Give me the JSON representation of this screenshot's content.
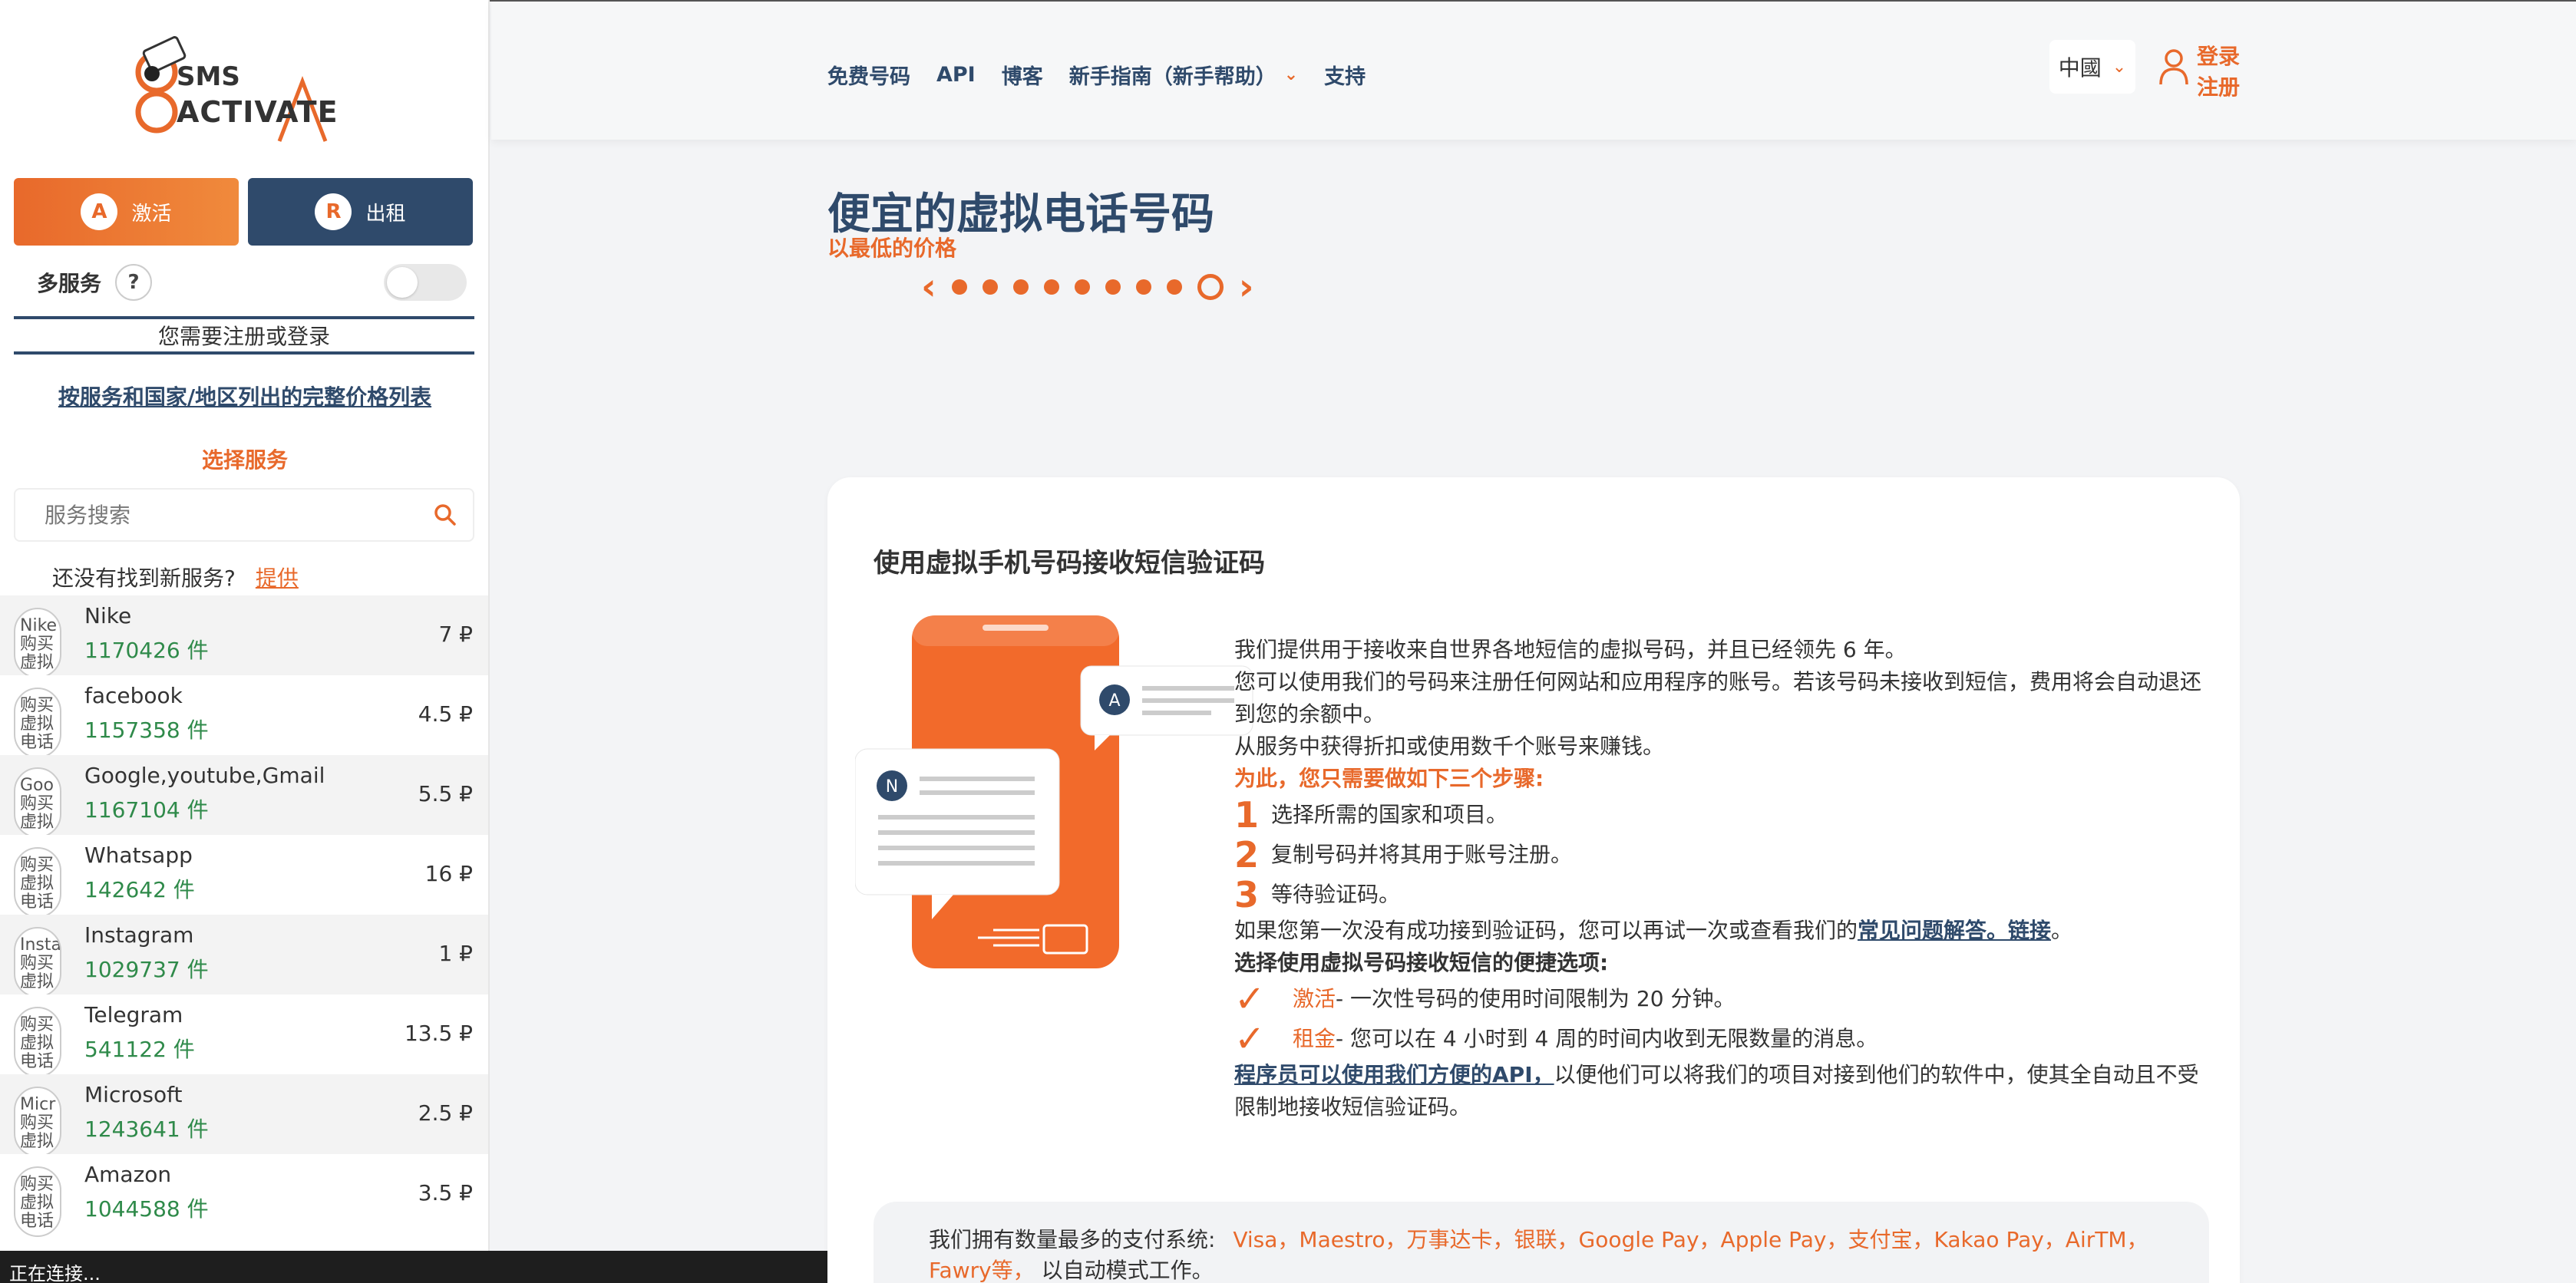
{
  "sidebar": {
    "logo": {
      "line1": "SMS",
      "line2": "ACTIVATE"
    },
    "modes": {
      "activate": "激活",
      "rent": "出租",
      "activate_icon_letter": "A",
      "rent_icon_letter": "R"
    },
    "multi_service_label": "多服务",
    "help_symbol": "?",
    "need_login": "您需要注册或登录",
    "price_list_link": "按服务和国家/地区列出的完整价格列表",
    "choose_service": "选择服务",
    "search_placeholder": "服务搜索",
    "not_found_text": "还没有找到新服务?",
    "offer_link": "提供",
    "services": [
      {
        "name": "Nike",
        "count": "1170426 件",
        "price": "7 ₽",
        "icon_alt": "Nike 购买虚拟",
        "icon": "nike-logo"
      },
      {
        "name": "facebook",
        "count": "1157358 件",
        "price": "4.5 ₽",
        "icon_alt": "购买虚拟电话",
        "icon": "facebook-logo"
      },
      {
        "name": "Google,youtube,Gmail",
        "count": "1167104 件",
        "price": "5.5 ₽",
        "icon_alt": "Goo 购买虚拟",
        "icon": "google-logo"
      },
      {
        "name": "Whatsapp",
        "count": "142642 件",
        "price": "16 ₽",
        "icon_alt": "购买虚拟电话",
        "icon": "whatsapp-logo"
      },
      {
        "name": "Instagram",
        "count": "1029737 件",
        "price": "1 ₽",
        "icon_alt": "Insta 购买虚拟",
        "icon": "instagram-logo"
      },
      {
        "name": "Telegram",
        "count": "541122 件",
        "price": "13.5 ₽",
        "icon_alt": "购买虚拟电话",
        "icon": "telegram-logo"
      },
      {
        "name": "Microsoft",
        "count": "1243641 件",
        "price": "2.5 ₽",
        "icon_alt": "Micr 购买虚拟",
        "icon": "microsoft-logo"
      },
      {
        "name": "Amazon",
        "count": "1044588 件",
        "price": "3.5 ₽",
        "icon_alt": "购买虚拟电话",
        "icon": "amazon-logo"
      }
    ]
  },
  "status_bar": "正在连接...",
  "header": {
    "nav": [
      "免费号码",
      "API",
      "博客",
      "新手指南（新手帮助）",
      "支持"
    ],
    "language": "中國",
    "login": "登录",
    "register": "注册"
  },
  "hero": {
    "title": "便宜的虚拟电话号码",
    "subtitle": "以最低的价格",
    "slide_count": 9,
    "active_slide": 9
  },
  "card": {
    "title": "使用虚拟手机号码接收短信验证码",
    "art": {
      "bubble_a": "A",
      "bubble_n": "N"
    },
    "p1": "我们提供用于接收来自世界各地短信的虚拟号码，并且已经领先 6 年。",
    "p2": "您可以使用我们的号码来注册任何网站和应用程序的账号。若该号码未接收到短信，费用将会自动退还到您的余额中。",
    "p3": "从服务中获得折扣或使用数千个账号来赚钱。",
    "steps_heading": "为此，您只需要做如下三个步骤:",
    "steps": [
      {
        "num": "1",
        "text": "选择所需的国家和项目。"
      },
      {
        "num": "2",
        "text": "复制号码并将其用于账号注册。"
      },
      {
        "num": "3",
        "text": "等待验证码。"
      }
    ],
    "retry_text": "如果您第一次没有成功接到验证码，您可以再试一次或查看我们的",
    "faq_link": "常见问题解答。链接",
    "retry_end": "。",
    "options_heading": "选择使用虚拟号码接收短信的便捷选项:",
    "options": [
      {
        "name": "激活",
        "text": " - 一次性号码的使用时间限制为 20 分钟。"
      },
      {
        "name": "租金",
        "text": " - 您可以在 4 小时到 4 周的时间内收到无限数量的消息。"
      }
    ],
    "api_link": "程序员可以使用我们方便的API，",
    "api_text": "以便他们可以将我们的项目对接到他们的软件中，使其全自动且不受限制地接收短信验证码。",
    "payment_prefix": "我们拥有数量最多的支付系统:",
    "payment_methods": "Visa，Maestro，万事达卡，银联，Google Pay，Apple Pay，支付宝，Kakao Pay，AirTM，Fawry等，",
    "payment_suffix": "以自动模式工作。"
  },
  "colors": {
    "accent": "#e8692b",
    "navy": "#2f4a6b",
    "green": "#2f8a4a"
  }
}
